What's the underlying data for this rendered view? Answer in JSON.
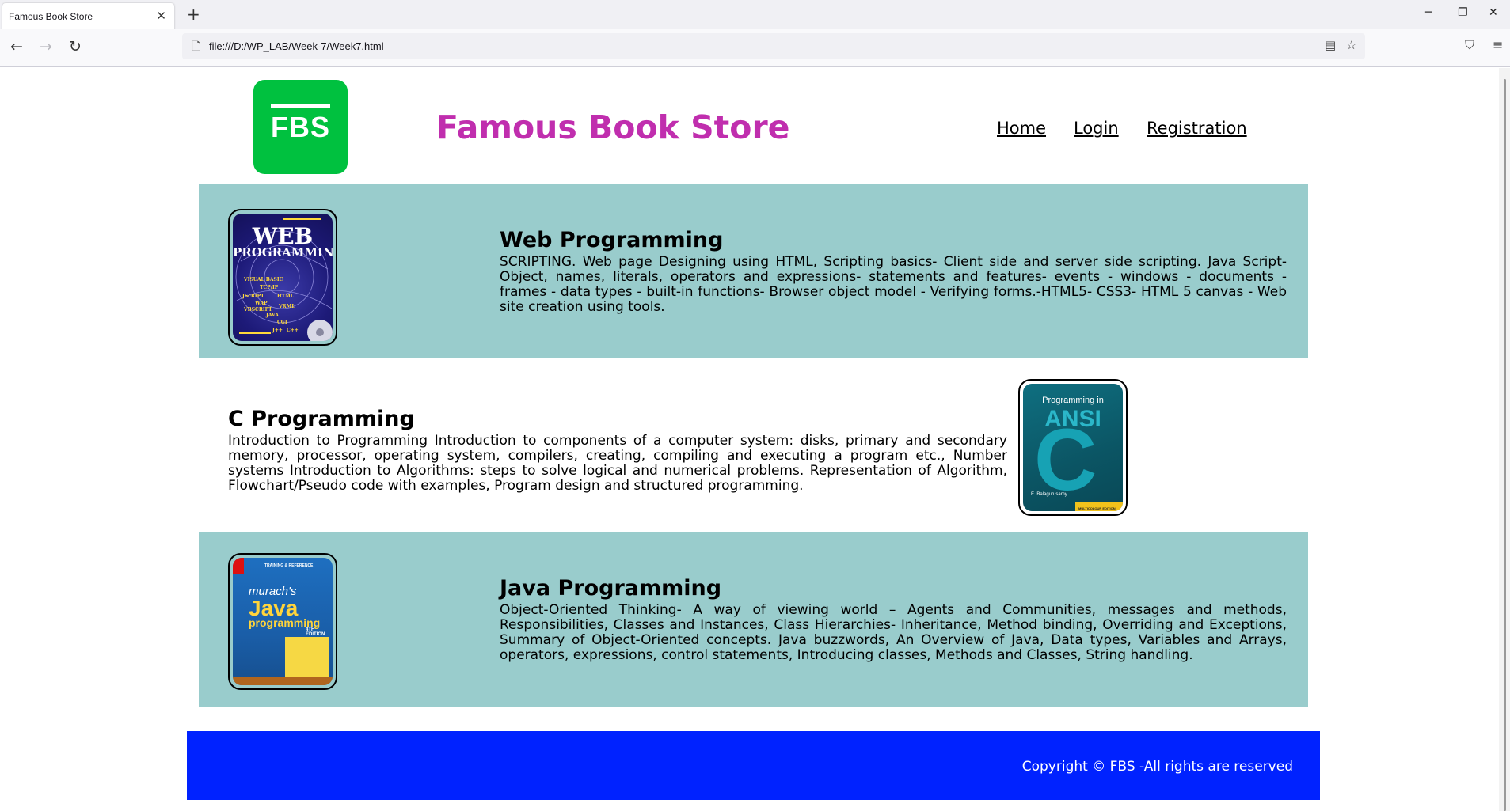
{
  "browser": {
    "tab_title": "Famous Book Store",
    "url": "file:///D:/WP_LAB/Week-7/Week7.html"
  },
  "header": {
    "logo_text": "FBS",
    "title": "Famous Book Store",
    "title_color": "#c02eae",
    "nav": [
      "Home",
      "Login",
      "Registration"
    ]
  },
  "books": [
    {
      "title": "Web Programming",
      "description": "SCRIPTING. Web page Designing using HTML, Scripting basics- Client side and server side scripting. Java Script- Object, names, literals, operators and expressions- statements and features- events - windows - documents - frames - data types - built-in functions- Browser object model - Verifying forms.-HTML5- CSS3- HTML 5 canvas - Web site creation using tools.",
      "cover_lines": [
        "WEB",
        "PROGRAMMING",
        "VISUAL BASIC",
        "TCP/IP",
        "JScRIPT",
        "HTML",
        "WAP",
        "VRML",
        "VBSCRIPT",
        "JAVA",
        "CGI",
        "J++",
        "C++"
      ]
    },
    {
      "title": "C Programming",
      "description": "Introduction to Programming Introduction to components of a computer system: disks, primary and secondary memory, processor, operating system, compilers, creating, compiling and executing a program etc., Number systems Introduction to Algorithms: steps to solve logical and numerical problems. Representation of Algorithm, Flowchart/Pseudo code with examples, Program design and structured programming.",
      "cover_lines": [
        "Programming in",
        "ANSI",
        "C",
        "E. Balagurusamy",
        "MULTICOLOUR EDITION"
      ]
    },
    {
      "title": "Java Programming",
      "description": "Object-Oriented Thinking- A way of viewing world – Agents and Communities, messages and methods, Responsibilities, Classes and Instances, Class Hierarchies- Inheritance, Method binding, Overriding and Exceptions, Summary of Object-Oriented concepts. Java buzzwords, An Overview of Java, Data types, Variables and Arrays, operators, expressions, control statements, Introducing classes, Methods and Classes, String handling.",
      "cover_lines": [
        "TRAINING & REFERENCE",
        "murach's",
        "Java",
        "programming",
        "4TH EDITION"
      ]
    }
  ],
  "footer": {
    "text": "Copyright © FBS -All rights are reserved"
  },
  "colors": {
    "section_bg": "#99cccc",
    "footer_bg": "#0022ff",
    "logo_bg": "#00c13f"
  }
}
